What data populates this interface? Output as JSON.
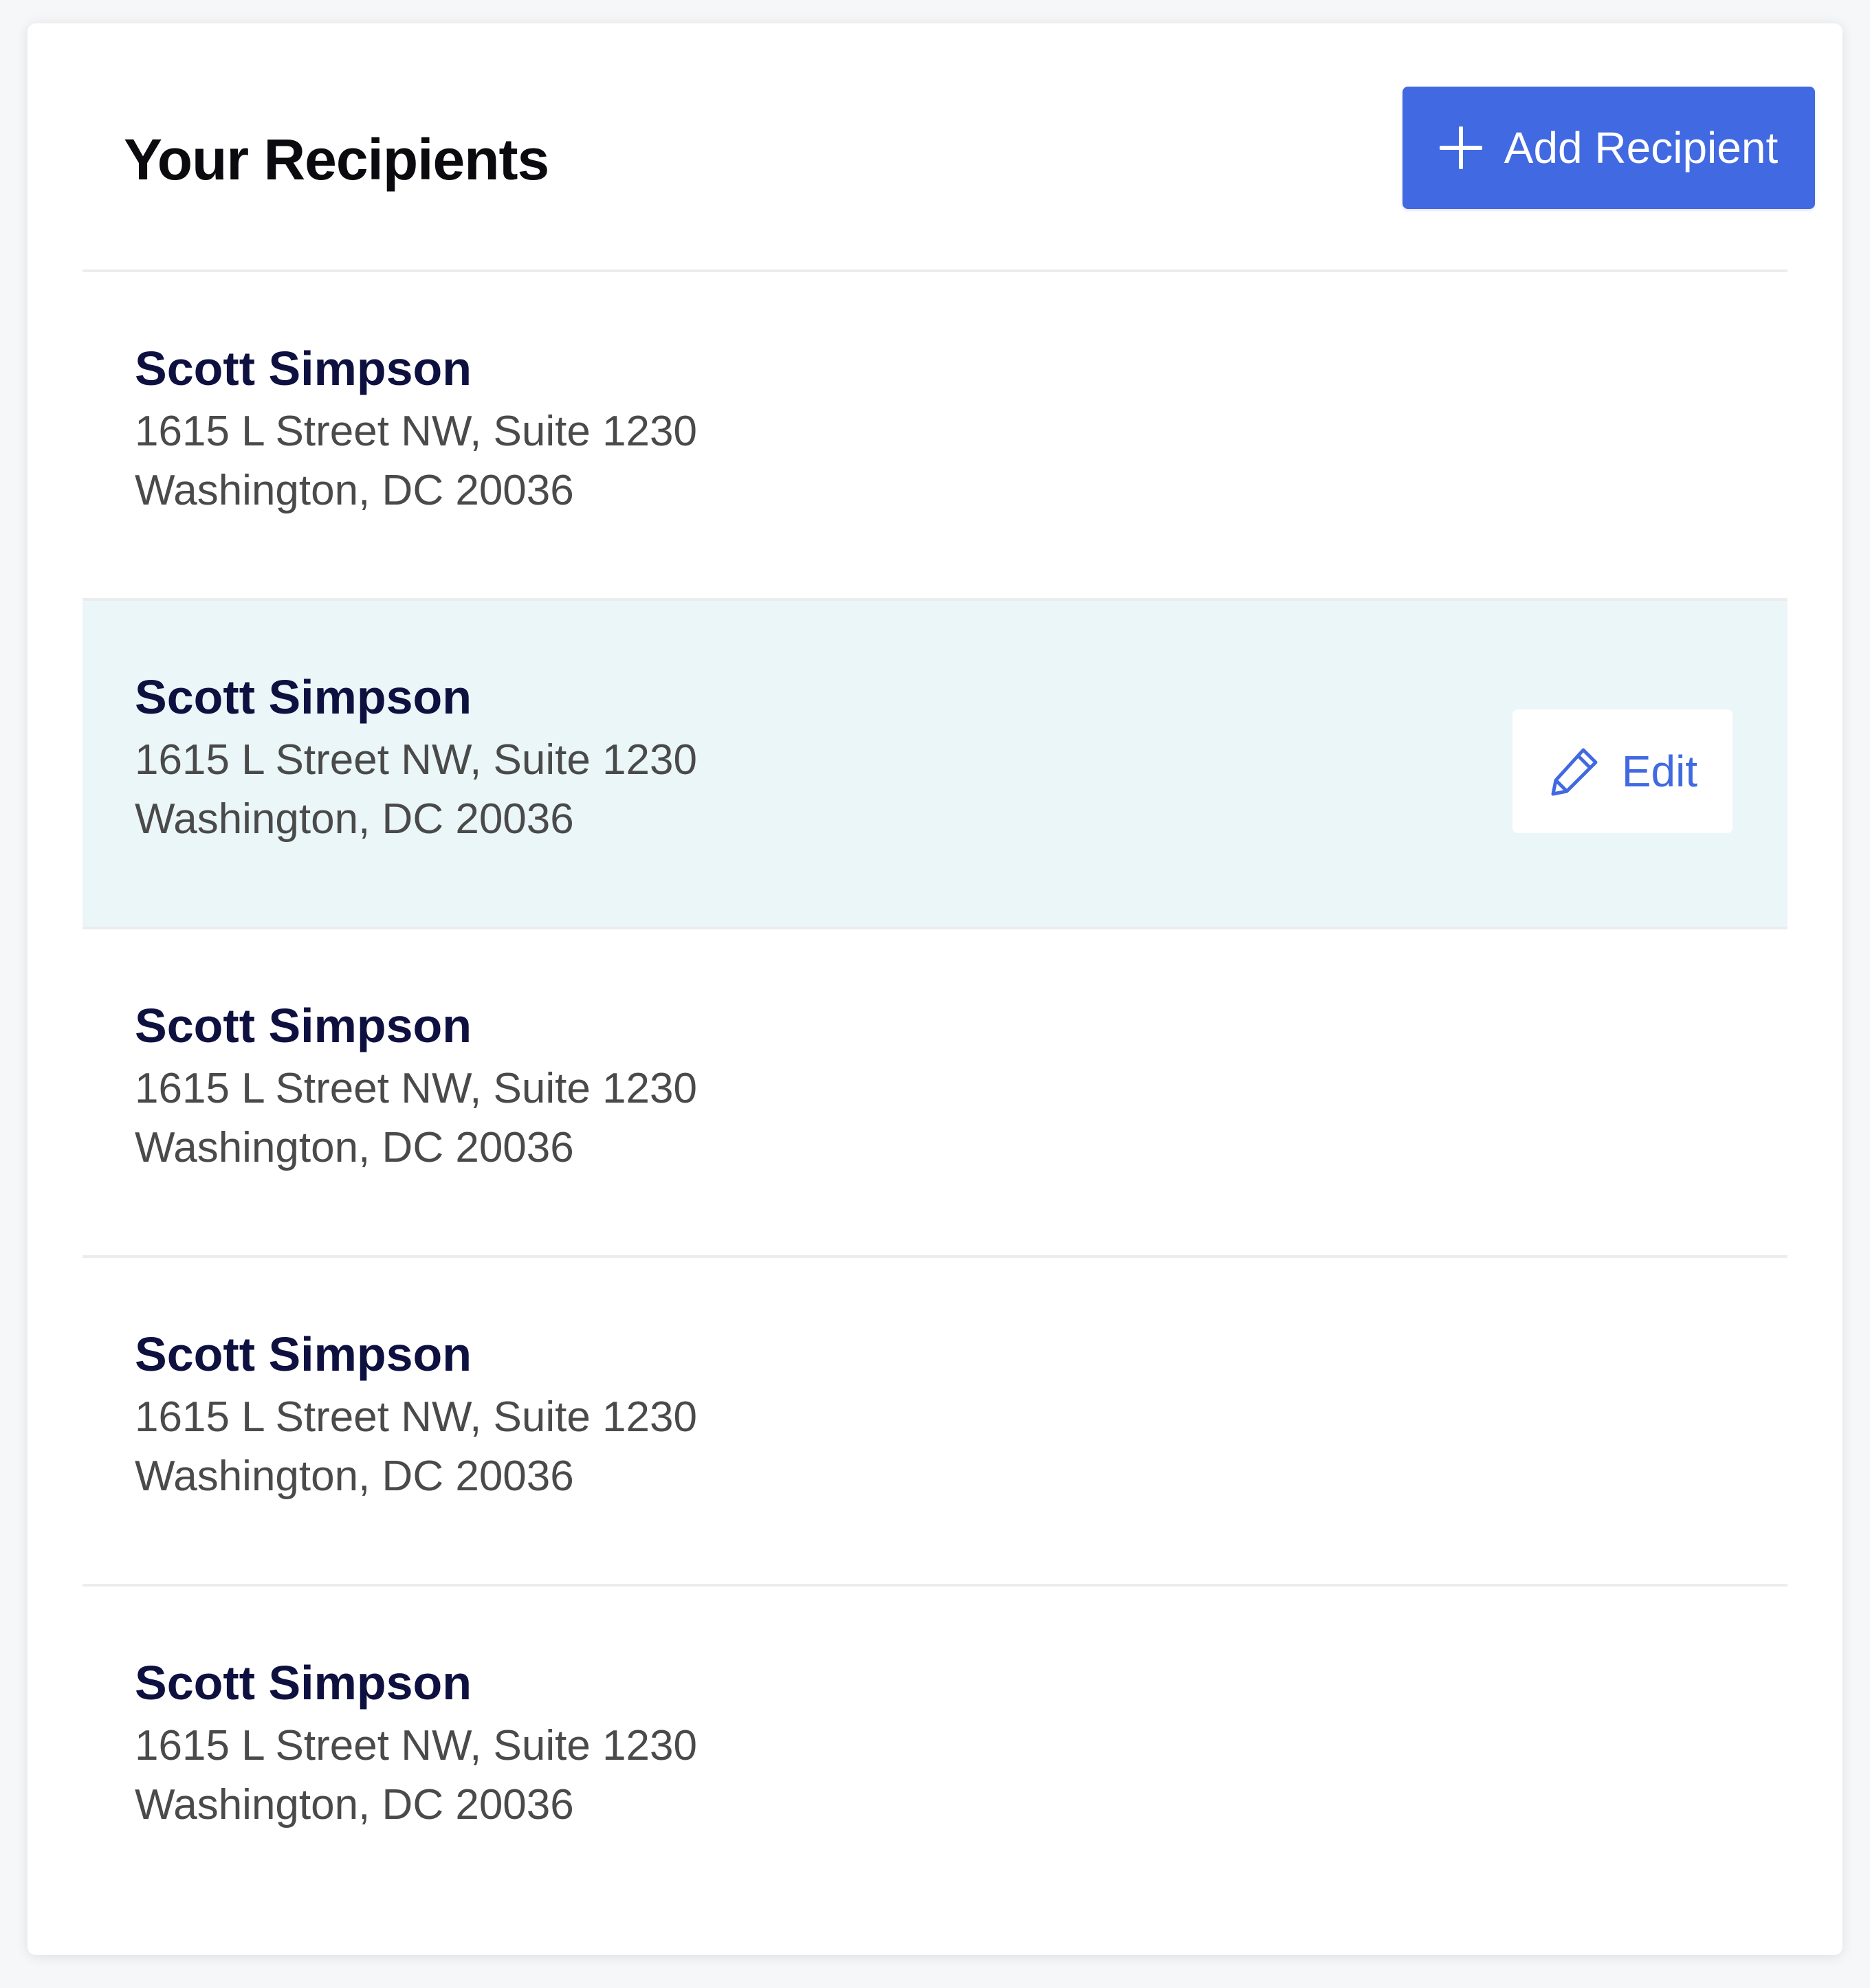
{
  "header": {
    "title": "Your Recipients",
    "add_button_label": "Add Recipient",
    "add_button_icon": "plus-icon"
  },
  "colors": {
    "accent": "#4169e1",
    "name_text": "#0e1140",
    "address_text": "#4a4a4a",
    "hover_row_bg": "#ebf6f8"
  },
  "recipients": [
    {
      "name": "Scott Simpson",
      "address_line1": "1615 L Street NW, Suite 1230",
      "address_line2": "Washington, DC 20036"
    },
    {
      "name": "Scott Simpson",
      "address_line1": "1615 L Street NW, Suite 1230",
      "address_line2": "Washington, DC 20036"
    },
    {
      "name": "Scott Simpson",
      "address_line1": "1615 L Street NW, Suite 1230",
      "address_line2": "Washington, DC 20036"
    },
    {
      "name": "Scott Simpson",
      "address_line1": "1615 L Street NW, Suite 1230",
      "address_line2": "Washington, DC 20036"
    },
    {
      "name": "Scott Simpson",
      "address_line1": "1615 L Street NW, Suite 1230",
      "address_line2": "Washington, DC 20036"
    }
  ],
  "edit": {
    "label": "Edit",
    "icon": "pencil-icon",
    "row_index": 1
  }
}
